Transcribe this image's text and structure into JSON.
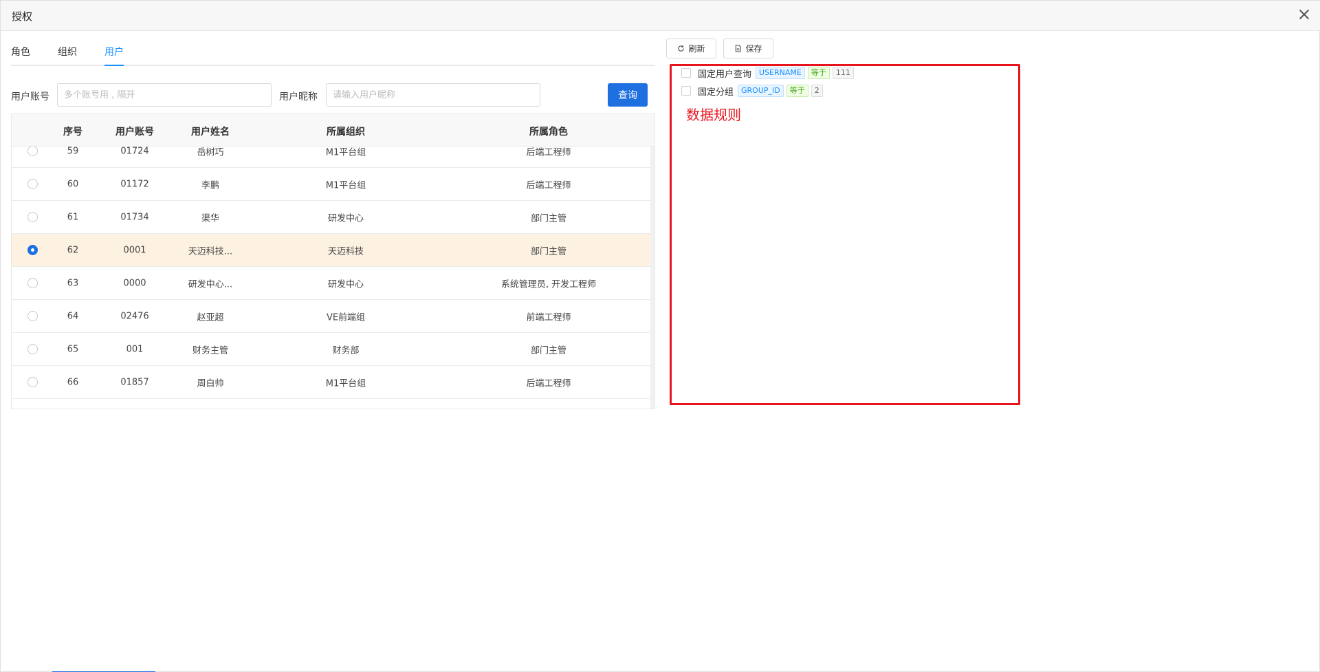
{
  "dialog": {
    "title": "授权"
  },
  "tabs": [
    {
      "label": "角色",
      "active": false
    },
    {
      "label": "组织",
      "active": false
    },
    {
      "label": "用户",
      "active": true
    }
  ],
  "search": {
    "account_label": "用户账号",
    "account_placeholder": "多个账号用 , 隔开",
    "nickname_label": "用户昵称",
    "nickname_placeholder": "请输入用户昵称",
    "query_button": "查询"
  },
  "table": {
    "columns": [
      "序号",
      "用户账号",
      "用户姓名",
      "所属组织",
      "所属角色"
    ],
    "rows": [
      {
        "index": "59",
        "account": "01724",
        "name": "岳树巧",
        "org": "M1平台组",
        "role": "后端工程师",
        "selected": false
      },
      {
        "index": "60",
        "account": "01172",
        "name": "李鹏",
        "org": "M1平台组",
        "role": "后端工程师",
        "selected": false
      },
      {
        "index": "61",
        "account": "01734",
        "name": "渠华",
        "org": "研发中心",
        "role": "部门主管",
        "selected": false
      },
      {
        "index": "62",
        "account": "0001",
        "name": "天迈科技...",
        "org": "天迈科技",
        "role": "部门主管",
        "selected": true
      },
      {
        "index": "63",
        "account": "0000",
        "name": "研发中心...",
        "org": "研发中心",
        "role": "系统管理员, 开发工程师",
        "selected": false
      },
      {
        "index": "64",
        "account": "02476",
        "name": "赵亚超",
        "org": "VE前端组",
        "role": "前端工程师",
        "selected": false
      },
      {
        "index": "65",
        "account": "001",
        "name": "财务主管",
        "org": "财务部",
        "role": "部门主管",
        "selected": false
      },
      {
        "index": "66",
        "account": "01857",
        "name": "周白帅",
        "org": "M1平台组",
        "role": "后端工程师",
        "selected": false
      }
    ]
  },
  "toolbar": {
    "refresh_label": "刷新",
    "save_label": "保存"
  },
  "rules": [
    {
      "name": "固定用户查询",
      "field": "USERNAME",
      "op": "等于",
      "value": "111"
    },
    {
      "name": "固定分组",
      "field": "GROUP_ID",
      "op": "等于",
      "value": "2"
    }
  ],
  "annotation": "数据规则",
  "colors": {
    "primary": "#1e6fe0",
    "annotation_red": "#e8141c",
    "selected_row": "#fdf1e1"
  }
}
